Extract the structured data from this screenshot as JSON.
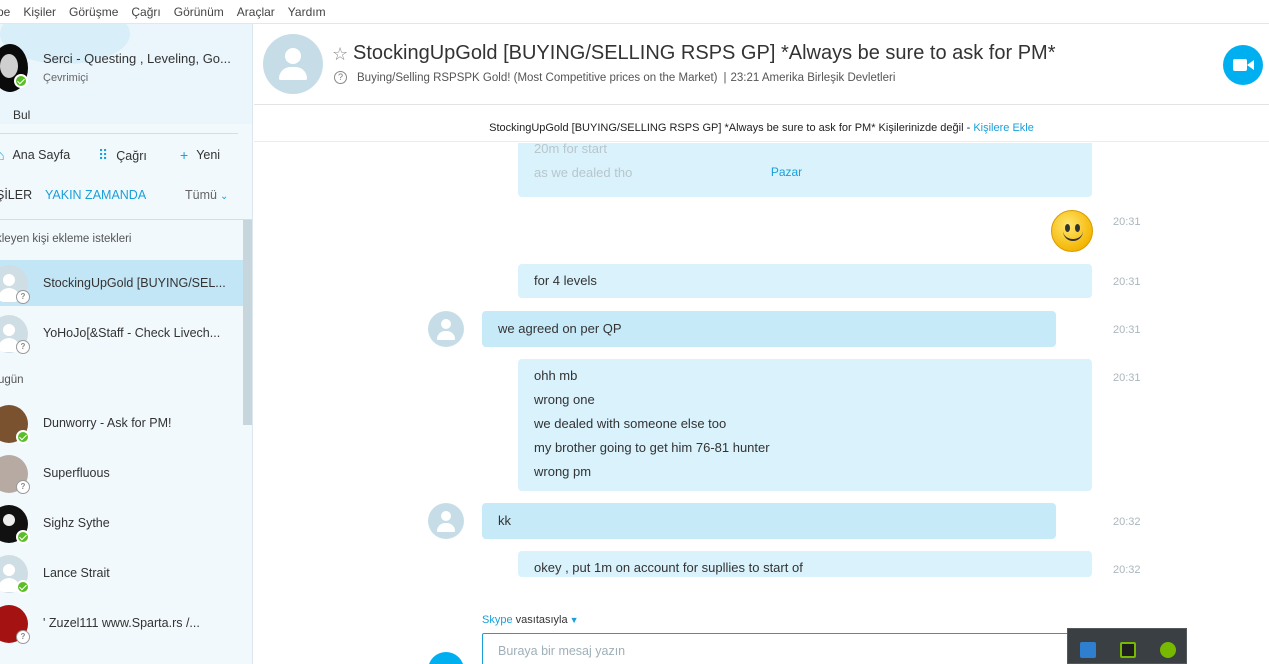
{
  "menu": [
    "pe",
    "Kişiler",
    "Görüşme",
    "Çağrı",
    "Görünüm",
    "Araçlar",
    "Yardım"
  ],
  "profile": {
    "name": "Serci - Questing , Leveling, Go...",
    "status": "Çevrimiçi"
  },
  "search": {
    "label": "Bul"
  },
  "nav": {
    "home": "Ana Sayfa",
    "call": "Çağrı",
    "new": "Yeni"
  },
  "tabs": {
    "contacts": "ŞİLER",
    "recent": "YAKIN ZAMANDA",
    "all": "Tümü"
  },
  "pending_requests": "kleyen kişi ekleme istekleri",
  "section_today": "ugün",
  "contacts": [
    {
      "name": "StockingUpGold [BUYING/SEL...",
      "status": "unknown",
      "selected": true
    },
    {
      "name": "YoHoJo[&Staff - Check Livech...",
      "status": "unknown",
      "selected": false
    },
    {
      "name": "Dunworry - Ask for PM!",
      "status": "online",
      "selected": false
    },
    {
      "name": "Superfluous",
      "status": "unknown",
      "selected": false
    },
    {
      "name": "Sighz Sythe",
      "status": "online",
      "selected": false
    },
    {
      "name": "Lance Strait",
      "status": "online",
      "selected": false
    },
    {
      "name": "' Zuzel111  www.Sparta.rs /...",
      "status": "unknown",
      "selected": false
    }
  ],
  "header": {
    "title": "StockingUpGold [BUYING/SELLING RSPS GP] *Always be sure to ask for PM*",
    "mood": "Buying/Selling RSPSPK Gold! (Most Competitive prices on the Market)",
    "sep": "|",
    "local_time": "23:21 Amerika Birleşik Devletleri"
  },
  "notice": {
    "text": "StockingUpGold [BUYING/SELLING RSPS GP] *Always be sure to ask for PM* Kişilerinizde değil - ",
    "link": "Kişilere Ekle"
  },
  "chat": {
    "date_separator": "Pazar",
    "faded_lines": [
      "20m for start",
      "as we dealed tho"
    ],
    "messages": [
      {
        "lines": [
          "for 4 levels"
        ],
        "time": "20:31"
      },
      {
        "lines": [
          "we agreed on per QP"
        ],
        "time": "20:31"
      },
      {
        "lines": [
          "ohh mb",
          "wrong one",
          "we dealed with someone else too",
          "my brother going to get him 76-81 hunter",
          "wrong pm"
        ],
        "time": "20:31"
      },
      {
        "lines": [
          "kk"
        ],
        "time": "20:32"
      },
      {
        "lines": [
          "okey , put 1m on account for supllies to start of"
        ],
        "time": "20:32"
      }
    ],
    "emoticon_time": "20:31"
  },
  "compose": {
    "via_service": "Skype",
    "via_text": "vasıtasıyla",
    "placeholder": "Buraya bir mesaj yazın"
  },
  "colors": {
    "accent": "#00aff0",
    "link": "#1a9fd9",
    "bubble": "#d9f2fc",
    "online": "#5cbd2a"
  }
}
